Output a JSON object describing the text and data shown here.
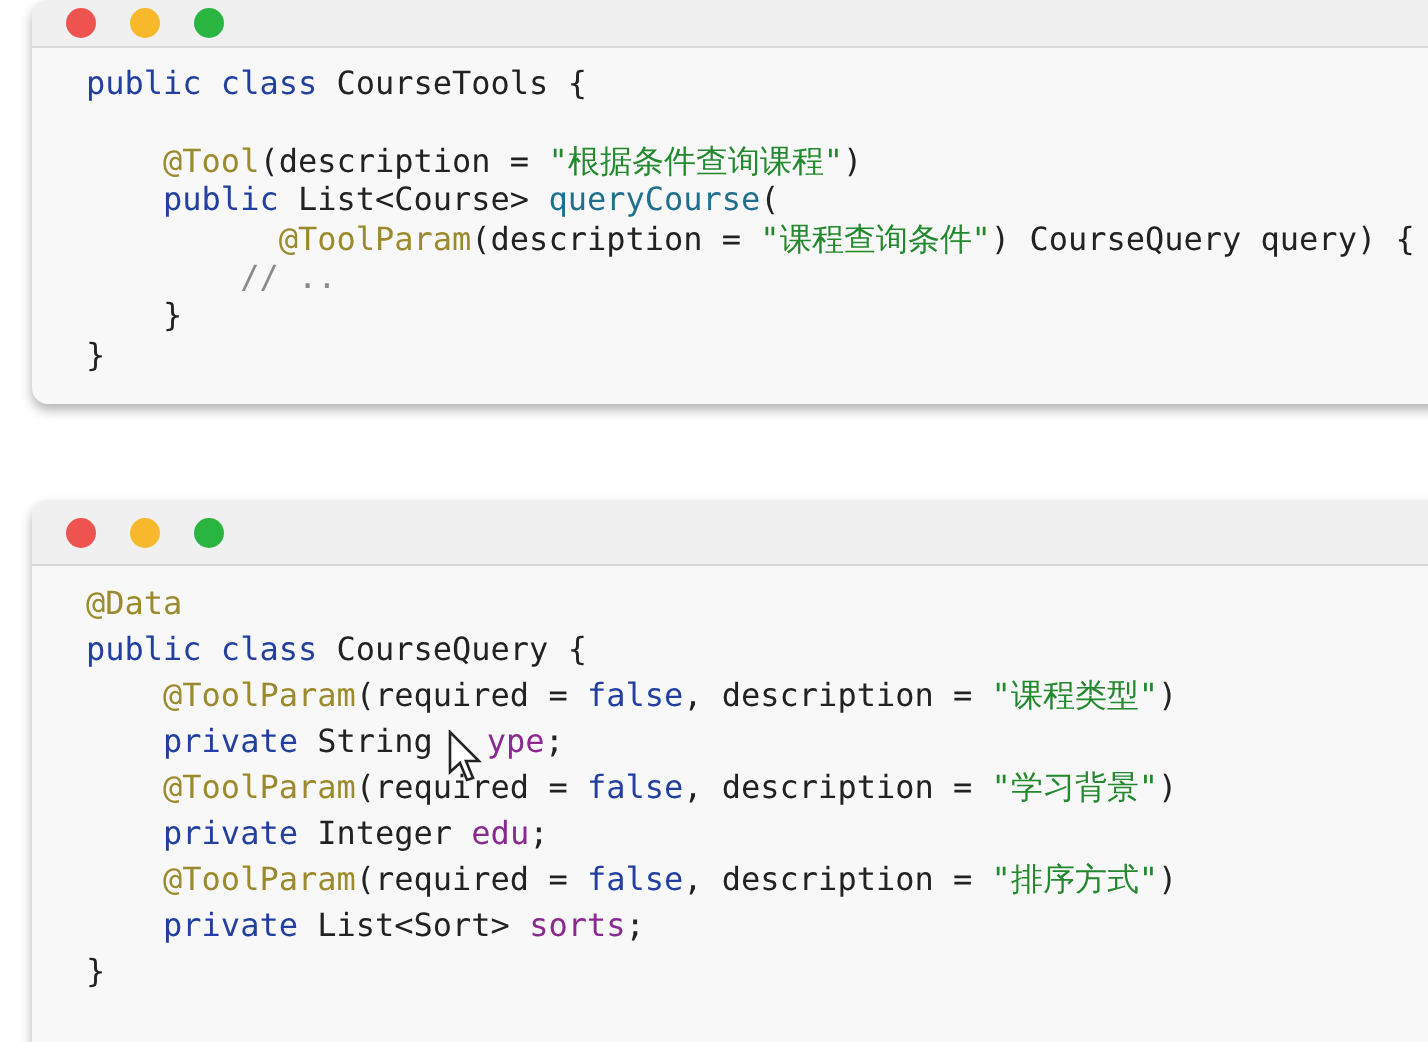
{
  "windows": [
    {
      "lines": [
        {
          "parts": [
            [
              {
                "kind": "keyword",
                "text": "public class"
              },
              {
                "kind": "plain",
                "text": " CourseTools {"
              }
            ]
          ]
        },
        {
          "blank_before": true,
          "parts": [
            [
              {
                "kind": "annotation",
                "text": "    @Tool"
              },
              {
                "kind": "plain",
                "text": "(description = "
              },
              {
                "kind": "string",
                "text": "\"根据条件查询课程\""
              },
              {
                "kind": "plain",
                "text": ")"
              }
            ]
          ]
        },
        {
          "parts": [
            [
              {
                "kind": "keyword",
                "text": "    public"
              },
              {
                "kind": "plain",
                "text": " List<Course> "
              },
              {
                "kind": "method",
                "text": "queryCourse"
              },
              {
                "kind": "plain",
                "text": "("
              }
            ]
          ]
        },
        {
          "parts": [
            [
              {
                "kind": "annotation",
                "text": "          @ToolParam"
              },
              {
                "kind": "plain",
                "text": "(description = "
              },
              {
                "kind": "string",
                "text": "\"课程查询条件\""
              },
              {
                "kind": "plain",
                "text": ") CourseQuery query) {"
              }
            ]
          ]
        },
        {
          "parts": [
            [
              {
                "kind": "comment",
                "text": "        // .."
              }
            ]
          ]
        },
        {
          "parts": [
            [
              {
                "kind": "plain",
                "text": "    }"
              }
            ]
          ]
        },
        {
          "parts": [
            [
              {
                "kind": "plain",
                "text": "}"
              }
            ]
          ]
        }
      ]
    },
    {
      "lines": [
        {
          "parts": [
            [
              {
                "kind": "annotation",
                "text": "@Data"
              }
            ]
          ]
        },
        {
          "parts": [
            [
              {
                "kind": "keyword",
                "text": "public class"
              },
              {
                "kind": "plain",
                "text": " CourseQuery {"
              }
            ]
          ]
        },
        {
          "parts": [
            [
              {
                "kind": "annotation",
                "text": "    @ToolParam"
              },
              {
                "kind": "plain",
                "text": "(required = "
              },
              {
                "kind": "keyword",
                "text": "false"
              },
              {
                "kind": "plain",
                "text": ", description = "
              },
              {
                "kind": "string",
                "text": "\"课程类型\""
              },
              {
                "kind": "plain",
                "text": ")"
              }
            ]
          ]
        },
        {
          "parts": [
            [
              {
                "kind": "keyword",
                "text": "    private"
              },
              {
                "kind": "plain",
                "text": " String"
              }
            ],
            [
              {
                "kind": "field",
                "text": "ype"
              },
              {
                "kind": "plain",
                "text": ";"
              }
            ]
          ]
        },
        {
          "parts": [
            [
              {
                "kind": "annotation",
                "text": "    @ToolParam"
              },
              {
                "kind": "plain",
                "text": "(required = "
              },
              {
                "kind": "keyword",
                "text": "false"
              },
              {
                "kind": "plain",
                "text": ", description = "
              },
              {
                "kind": "string",
                "text": "\"学习背景\""
              },
              {
                "kind": "plain",
                "text": ")"
              }
            ]
          ]
        },
        {
          "parts": [
            [
              {
                "kind": "keyword",
                "text": "    private"
              },
              {
                "kind": "plain",
                "text": " Integer "
              },
              {
                "kind": "field",
                "text": "edu"
              },
              {
                "kind": "plain",
                "text": ";"
              }
            ]
          ]
        },
        {
          "parts": [
            [
              {
                "kind": "annotation",
                "text": "    @ToolParam"
              },
              {
                "kind": "plain",
                "text": "(required = "
              },
              {
                "kind": "keyword",
                "text": "false"
              },
              {
                "kind": "plain",
                "text": ", description = "
              },
              {
                "kind": "string",
                "text": "\"排序方式\""
              },
              {
                "kind": "plain",
                "text": ")"
              }
            ]
          ]
        },
        {
          "parts": [
            [
              {
                "kind": "keyword",
                "text": "    private"
              },
              {
                "kind": "plain",
                "text": " List<Sort> "
              },
              {
                "kind": "field",
                "text": "sorts"
              },
              {
                "kind": "plain",
                "text": ";"
              }
            ]
          ]
        },
        {
          "parts": [
            [
              {
                "kind": "plain",
                "text": "}"
              }
            ]
          ]
        }
      ]
    }
  ]
}
